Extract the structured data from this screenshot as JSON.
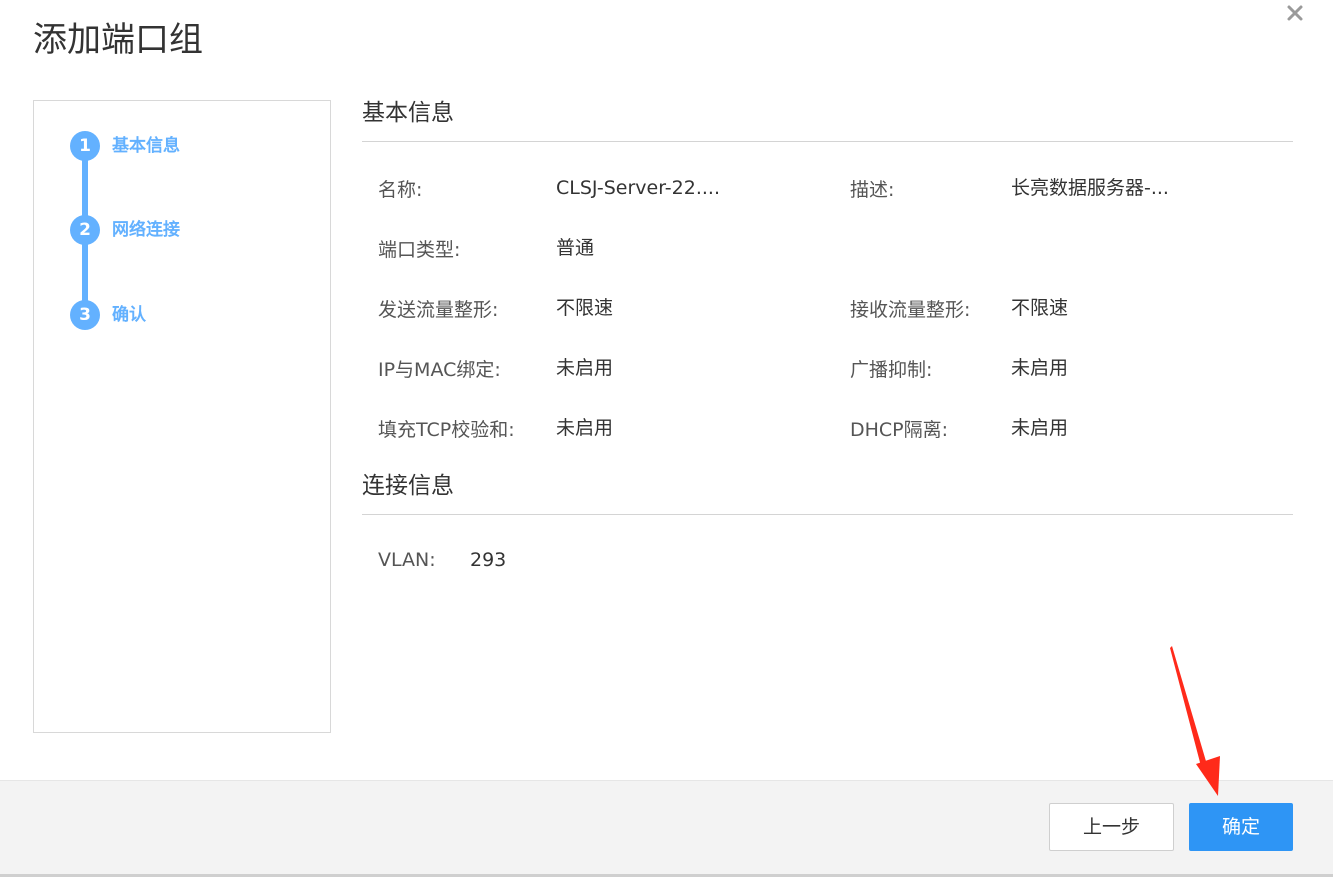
{
  "dialog": {
    "title": "添加端口组",
    "close_icon": "close-icon"
  },
  "steps": [
    {
      "number": "1",
      "label": "基本信息"
    },
    {
      "number": "2",
      "label": "网络连接"
    },
    {
      "number": "3",
      "label": "确认"
    }
  ],
  "basic_info": {
    "title": "基本信息",
    "fields": {
      "name": {
        "label": "名称:",
        "value": "CLSJ-Server-22...."
      },
      "description": {
        "label": "描述:",
        "value": "长亮数据服务器-..."
      },
      "port_type": {
        "label": "端口类型:",
        "value": "普通"
      },
      "send_shaping": {
        "label": "发送流量整形:",
        "value": "不限速"
      },
      "recv_shaping": {
        "label": "接收流量整形:",
        "value": "不限速"
      },
      "ip_mac_binding": {
        "label": "IP与MAC绑定:",
        "value": "未启用"
      },
      "broadcast_suppression": {
        "label": "广播抑制:",
        "value": "未启用"
      },
      "tcp_checksum": {
        "label": "填充TCP校验和:",
        "value": "未启用"
      },
      "dhcp_isolation": {
        "label": "DHCP隔离:",
        "value": "未启用"
      }
    }
  },
  "connection_info": {
    "title": "连接信息",
    "vlan": {
      "label": "VLAN:",
      "value": "293"
    }
  },
  "footer": {
    "prev_label": "上一步",
    "ok_label": "确定"
  },
  "colors": {
    "accent": "#2e95f5",
    "step": "#63b1ff",
    "annotation": "#ff2a1a"
  }
}
